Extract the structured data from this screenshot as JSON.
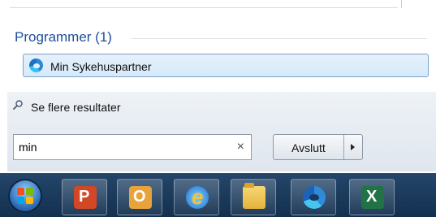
{
  "results": {
    "section_title": "Programmer (1)",
    "items": [
      {
        "label": "Min Sykehuspartner",
        "icon": "edge-icon"
      }
    ]
  },
  "see_more": {
    "label": "Se flere resultater",
    "icon": "search-icon"
  },
  "search": {
    "value": "min",
    "clear_symbol": "×"
  },
  "shutdown": {
    "label": "Avslutt"
  },
  "taskbar": {
    "apps": [
      {
        "name": "start-orb"
      },
      {
        "name": "powerpoint-icon"
      },
      {
        "name": "outlook-icon"
      },
      {
        "name": "internet-explorer-icon"
      },
      {
        "name": "file-explorer-icon"
      },
      {
        "name": "edge-icon"
      },
      {
        "name": "excel-icon"
      }
    ]
  },
  "colors": {
    "section_title": "#1f4e9a",
    "taskbar": "#1c3a5c",
    "highlight": "#d6e9f9"
  }
}
